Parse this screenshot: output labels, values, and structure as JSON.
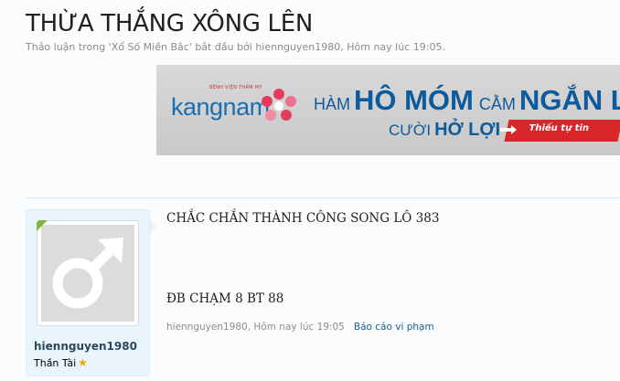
{
  "thread": {
    "title": "THỪA THẮNG XÔNG LÊN",
    "desc_prefix": "Thảo luận trong '",
    "forum": "Xổ Số Miền Bắc",
    "desc_mid": "' bắt đầu bởi ",
    "starter": "hiennguyen1980",
    "desc_suffix": ", Hôm nay lúc 19:05."
  },
  "banner": {
    "hospital_label": "BỆNH VIỆN THẨM MỸ",
    "brand": "kangnam",
    "line1_a": "HÀM",
    "line1_b": "HÔ MÓM",
    "line1_c": "CẰM",
    "line1_d": "NGẮN LẸM",
    "line2_a": "CƯỜI",
    "line2_b": "HỞ LỢI",
    "cta": "Thiếu tự tin"
  },
  "post": {
    "username": "hiennguyen1980",
    "user_title": "Thần Tài",
    "line1": "CHẮC CHẮN THÀNH CÔNG SONG LÔ 383",
    "line2": "ĐB CHẠM 8 BT 88",
    "meta_author": "hiennguyen1980",
    "meta_time": ", Hôm nay lúc 19:05",
    "report_label": "Báo cáo vi phạm"
  },
  "colors": {
    "accent_blue": "#176093",
    "card_bg": "#eaf4fd",
    "online_green": "#7fb73a",
    "banner_red": "#d9262b"
  },
  "icons": {
    "avatar": "male-symbol-icon",
    "title_badge": "star-icon"
  }
}
